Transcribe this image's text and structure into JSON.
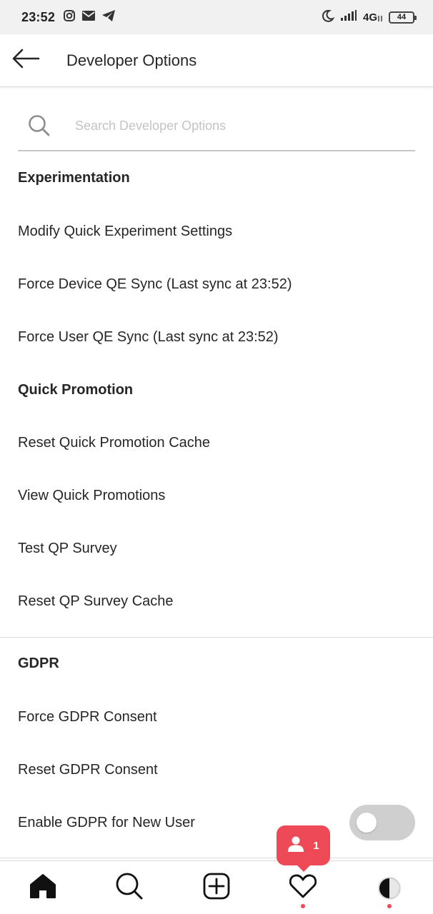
{
  "status_bar": {
    "time": "23:52",
    "network": "4G",
    "battery": "44",
    "notification_icons": [
      "instagram-icon",
      "mail-icon",
      "telegram-icon"
    ],
    "system_icons": [
      "moon-icon",
      "signal-icon",
      "network-icon",
      "battery-icon"
    ]
  },
  "header": {
    "title": "Developer Options",
    "back_icon": "arrow-left-icon"
  },
  "search": {
    "placeholder": "Search Developer Options",
    "value": "",
    "icon": "search-icon"
  },
  "sections": {
    "experimentation": {
      "title": "Experimentation",
      "items": [
        "Modify Quick Experiment Settings",
        "Force Device QE Sync (Last sync at 23:52)",
        "Force User QE Sync (Last sync at 23:52)"
      ]
    },
    "quick_promotion": {
      "title": "Quick Promotion",
      "items": [
        "Reset Quick Promotion Cache",
        "View Quick Promotions",
        "Test QP Survey",
        "Reset QP Survey Cache"
      ]
    },
    "gdpr": {
      "title": "GDPR",
      "items": [
        "Force GDPR Consent",
        "Reset GDPR Consent",
        "Enable GDPR for New User"
      ],
      "enable_new_user_toggle_on": false
    }
  },
  "notification_bubble": {
    "count": "1",
    "icon": "person-icon"
  },
  "tab_bar": {
    "tabs": [
      "home-icon",
      "search-icon",
      "new-post-icon",
      "activity-heart-icon",
      "profile-avatar"
    ],
    "active": "home",
    "dots_on": [
      "activity",
      "profile"
    ]
  },
  "colors": {
    "accent_red": "#ed4956",
    "text": "#262626",
    "divider": "#dbdbdb",
    "status_bar_bg": "#f1f1f1",
    "toggle_off": "#cfcfcf"
  }
}
